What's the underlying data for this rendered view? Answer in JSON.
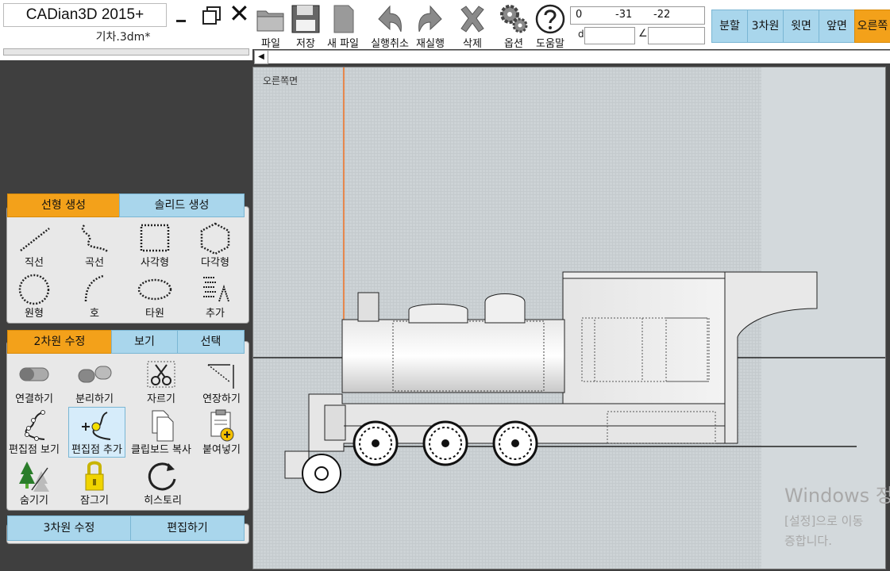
{
  "app": {
    "title": "CADian3D 2015+",
    "file_name": "기차.3dm*",
    "minimize_label": "_",
    "close_label": "✕"
  },
  "toolbar": {
    "buttons": [
      {
        "label": "파일",
        "icon": "folder-icon"
      },
      {
        "label": "저장",
        "icon": "floppy-icon"
      },
      {
        "label": "새 파일",
        "icon": "new-file-icon"
      },
      {
        "label": "실행취소",
        "icon": "undo-icon"
      },
      {
        "label": "재실행",
        "icon": "redo-icon"
      },
      {
        "label": "삭제",
        "icon": "delete-icon"
      },
      {
        "label": "옵션",
        "icon": "gear-icon"
      },
      {
        "label": "도움말",
        "icon": "help-icon"
      }
    ]
  },
  "coords": {
    "x": "0",
    "y": "-31",
    "z": "-22",
    "distance_label": "d",
    "angle_label": "∠"
  },
  "view_tabs": [
    {
      "label": "분할",
      "active": false
    },
    {
      "label": "3차원",
      "active": false
    },
    {
      "label": "윗면",
      "active": false
    },
    {
      "label": "앞면",
      "active": false
    },
    {
      "label": "오른쪽",
      "active": true
    }
  ],
  "create_panel": {
    "tabs": [
      {
        "label": "선형 생성",
        "active": true
      },
      {
        "label": "솔리드 생성",
        "active": false
      }
    ],
    "tools": [
      {
        "label": "직선",
        "icon": "line-icon"
      },
      {
        "label": "곡선",
        "icon": "curve-icon"
      },
      {
        "label": "사각형",
        "icon": "rectangle-icon"
      },
      {
        "label": "다각형",
        "icon": "polygon-icon"
      },
      {
        "label": "원형",
        "icon": "circle-icon"
      },
      {
        "label": "호",
        "icon": "arc-icon"
      },
      {
        "label": "타원",
        "icon": "ellipse-icon"
      },
      {
        "label": "추가",
        "icon": "more-icon"
      }
    ]
  },
  "edit_panel": {
    "tabs": [
      {
        "label": "2차원 수정",
        "active": true
      },
      {
        "label": "보기",
        "active": false
      },
      {
        "label": "선택",
        "active": false
      }
    ],
    "tools": [
      {
        "label": "연결하기",
        "icon": "join-icon"
      },
      {
        "label": "분리하기",
        "icon": "split-icon"
      },
      {
        "label": "자르기",
        "icon": "scissors-icon"
      },
      {
        "label": "연장하기",
        "icon": "extend-icon"
      },
      {
        "label": "편집점 보기",
        "icon": "show-points-icon"
      },
      {
        "label": "편집점 추가",
        "icon": "add-point-icon",
        "selected": true
      },
      {
        "label": "클립보드 복사",
        "icon": "copy-icon"
      },
      {
        "label": "붙여넣기",
        "icon": "paste-icon"
      },
      {
        "label": "숨기기",
        "icon": "hide-icon"
      },
      {
        "label": "잠그기",
        "icon": "lock-icon"
      },
      {
        "label": "히스토리",
        "icon": "history-icon"
      }
    ]
  },
  "bottom_tabs": [
    {
      "label": "3차원 수정"
    },
    {
      "label": "편집하기"
    }
  ],
  "viewport": {
    "name": "오른쪽면",
    "scroll_arrow": "◀"
  },
  "watermark": {
    "line1": "Windows 정",
    "line2": "[설정]으로 이동",
    "line3": "증합니다."
  },
  "colors": {
    "accent_orange": "#f3a11a",
    "tab_blue": "#a9d6ec",
    "panel_bg": "#3f3f3f"
  }
}
